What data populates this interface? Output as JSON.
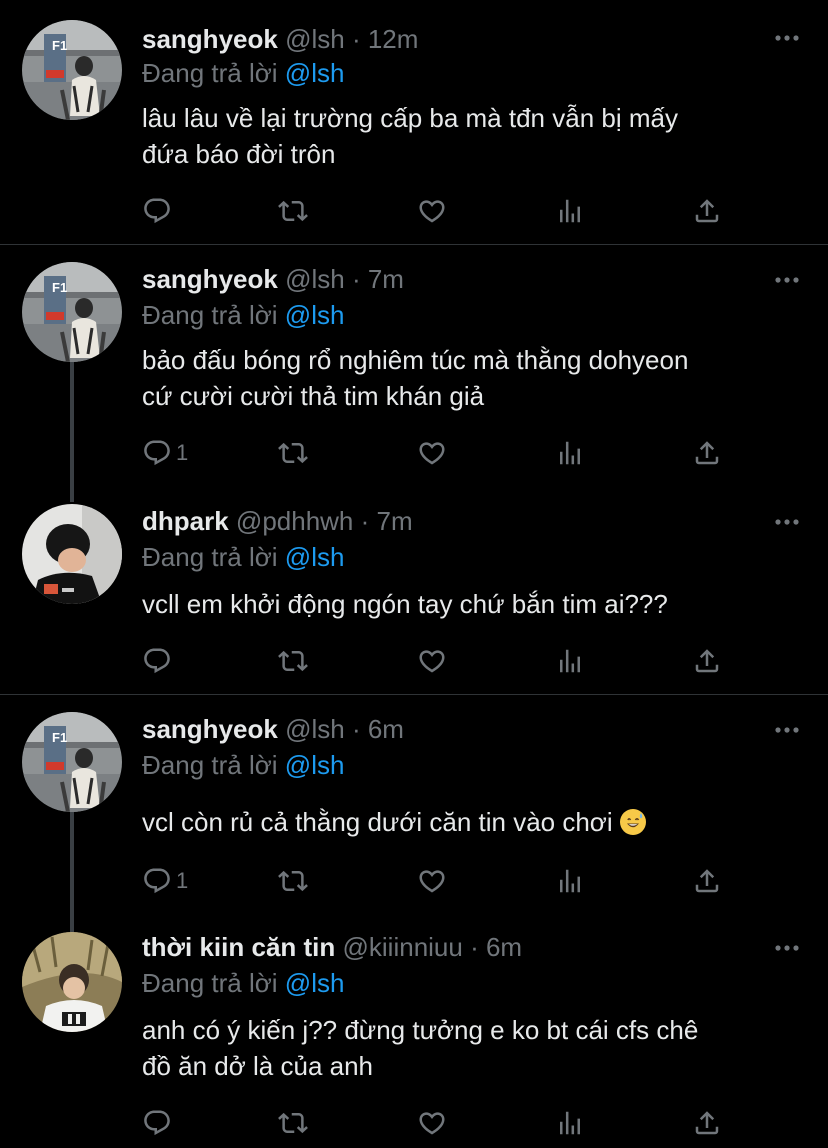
{
  "tweets": [
    {
      "name": "sanghyeok",
      "handle": "@lsh",
      "time": "· 12m",
      "reply_prefix": "Đang trả lời",
      "reply_to": "@lsh",
      "text_line1": "lâu lâu về lại trường cấp ba mà tđn vẫn bị mấy",
      "text_line2": "đứa báo đời trôn",
      "reply_count": "",
      "avatar": "avatar-sanghyeok"
    },
    {
      "name": "sanghyeok",
      "handle": "@lsh",
      "time": "· 7m",
      "reply_prefix": "Đang trả lời",
      "reply_to": "@lsh",
      "text_line1": "bảo đấu bóng rổ nghiêm túc mà thằng dohyeon",
      "text_line2": "cứ cười cười thả tim khán giả",
      "reply_count": "1",
      "avatar": "avatar-sanghyeok"
    },
    {
      "name": "dhpark",
      "handle": "@pdhhwh",
      "time": "· 7m",
      "reply_prefix": "Đang trả lời",
      "reply_to": "@lsh",
      "text_line1": "vcll em khởi động ngón tay chứ bắn tim ai???",
      "text_line2": "",
      "reply_count": "",
      "avatar": "avatar-dhpark"
    },
    {
      "name": "sanghyeok",
      "handle": "@lsh",
      "time": "· 6m",
      "reply_prefix": "Đang trả lời",
      "reply_to": "@lsh",
      "text_line1": "vcl còn rủ cả thằng dưới căn tin vào chơi",
      "text_line2": "",
      "reply_count": "1",
      "avatar": "avatar-sanghyeok"
    },
    {
      "name": "thời kiin căn tin",
      "handle": "@kiiinniuu",
      "time": "· 6m",
      "reply_prefix": "Đang trả lời",
      "reply_to": "@lsh",
      "text_line1": "anh có ý kiến j?? đừng tưởng e ko bt cái cfs chê",
      "text_line2": "đồ ăn dở là của anh",
      "reply_count": "",
      "avatar": "avatar-kiin"
    }
  ],
  "avatar_sign_text": "F1",
  "icons": {
    "reply": "reply-icon",
    "retweet": "retweet-icon",
    "like": "heart-icon",
    "views": "views-icon",
    "share": "share-icon",
    "more": "more-icon",
    "emoji": "grinning-sweat-emoji"
  },
  "colors": {
    "background": "#000000",
    "text": "#e7e9ea",
    "muted": "#71767b",
    "mention": "#1d9bf0",
    "divider": "#2f3336"
  }
}
